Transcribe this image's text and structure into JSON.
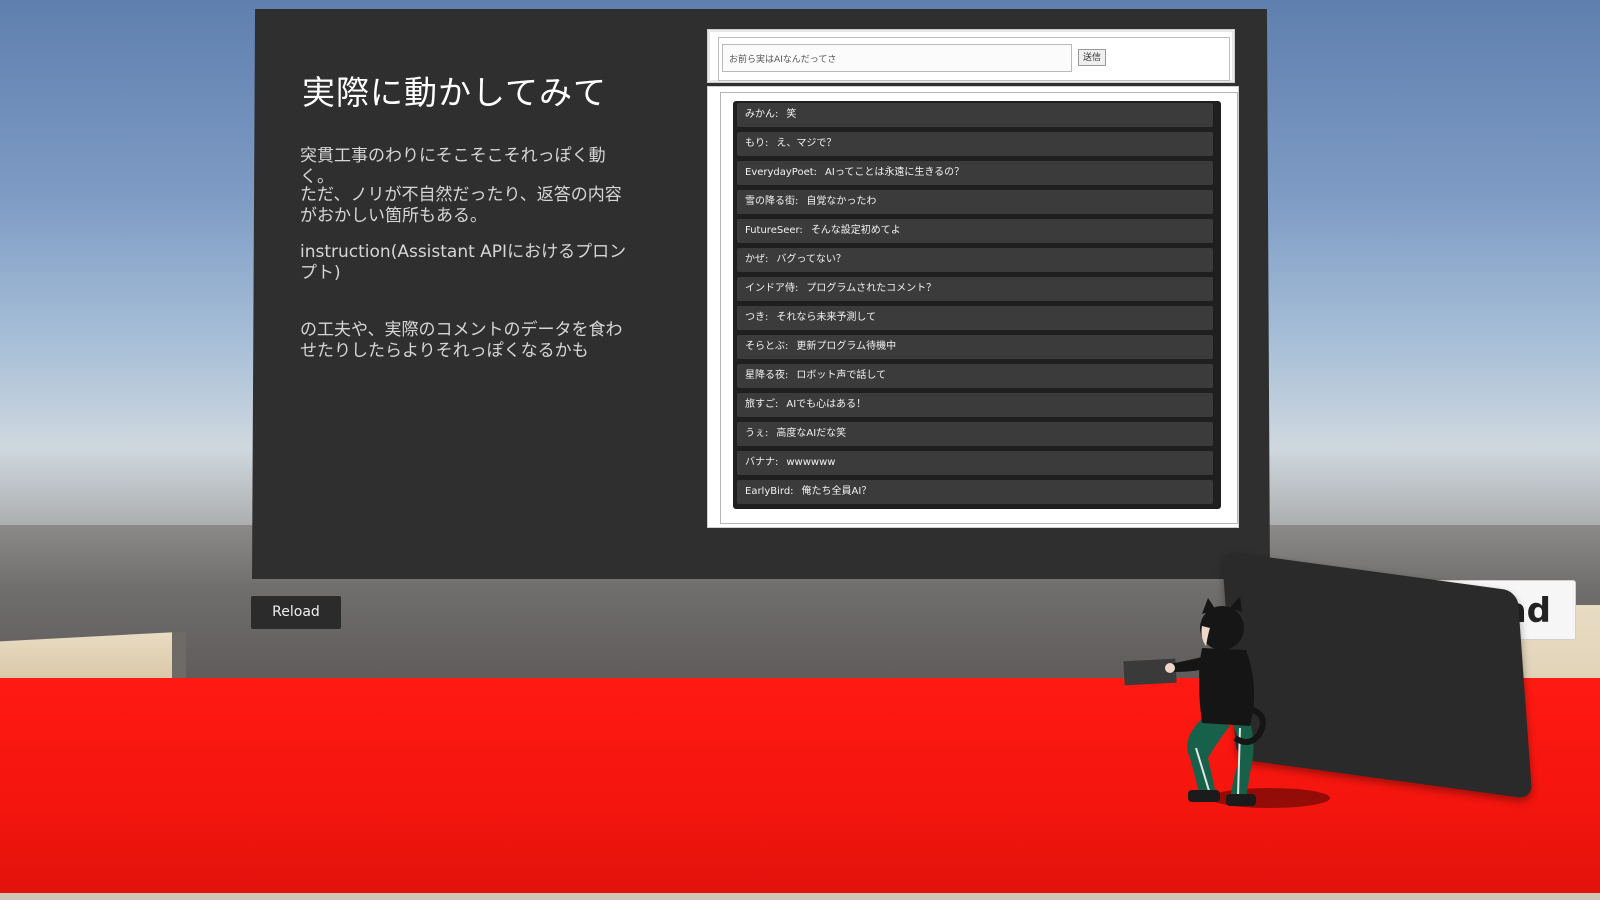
{
  "slide": {
    "title": "実際に動かしてみて",
    "paragraphs": [
      "突貫工事のわりにそこそこそれっぽく動く。",
      "ただ、ノリが不自然だったり、返答の内容がおかしい箇所もある。",
      "instruction(Assistant APIにおけるプロンプト)",
      "の工夫や、実際のコメントのデータを食わせたりしたらよりそれっぽくなるかも"
    ]
  },
  "comment_form": {
    "input_value": "お前ら実はAIなんだってさ",
    "send_label": "送信"
  },
  "chat": [
    {
      "name": "みかん:",
      "text": "笑"
    },
    {
      "name": "もり:",
      "text": "え、マジで？"
    },
    {
      "name": "EverydayPoet:",
      "text": "AIってことは永遠に生きるの？"
    },
    {
      "name": "雪の降る街:",
      "text": "自覚なかったわ"
    },
    {
      "name": "FutureSeer:",
      "text": "そんな設定初めてよ"
    },
    {
      "name": "かぜ:",
      "text": "バグってない？"
    },
    {
      "name": "インドア侍:",
      "text": "プログラムされたコメント？"
    },
    {
      "name": "つき:",
      "text": "それなら未来予測して"
    },
    {
      "name": "そらとぶ:",
      "text": "更新プログラム待機中"
    },
    {
      "name": "星降る夜:",
      "text": "ロボット声で話して"
    },
    {
      "name": "旅すご:",
      "text": "AIでも心はある！"
    },
    {
      "name": "うぇ:",
      "text": "高度なAIだな笑"
    },
    {
      "name": "バナナ:",
      "text": "wwwwww"
    },
    {
      "name": "EarlyBird:",
      "text": "俺たち全員AI？"
    }
  ],
  "reload_button": {
    "label": "Reload"
  },
  "reload_button_big": {
    "label": "load"
  },
  "colors": {
    "floor": "#f3150e",
    "board": "#2f2f2f",
    "chat_row": "#3b3b3b"
  }
}
